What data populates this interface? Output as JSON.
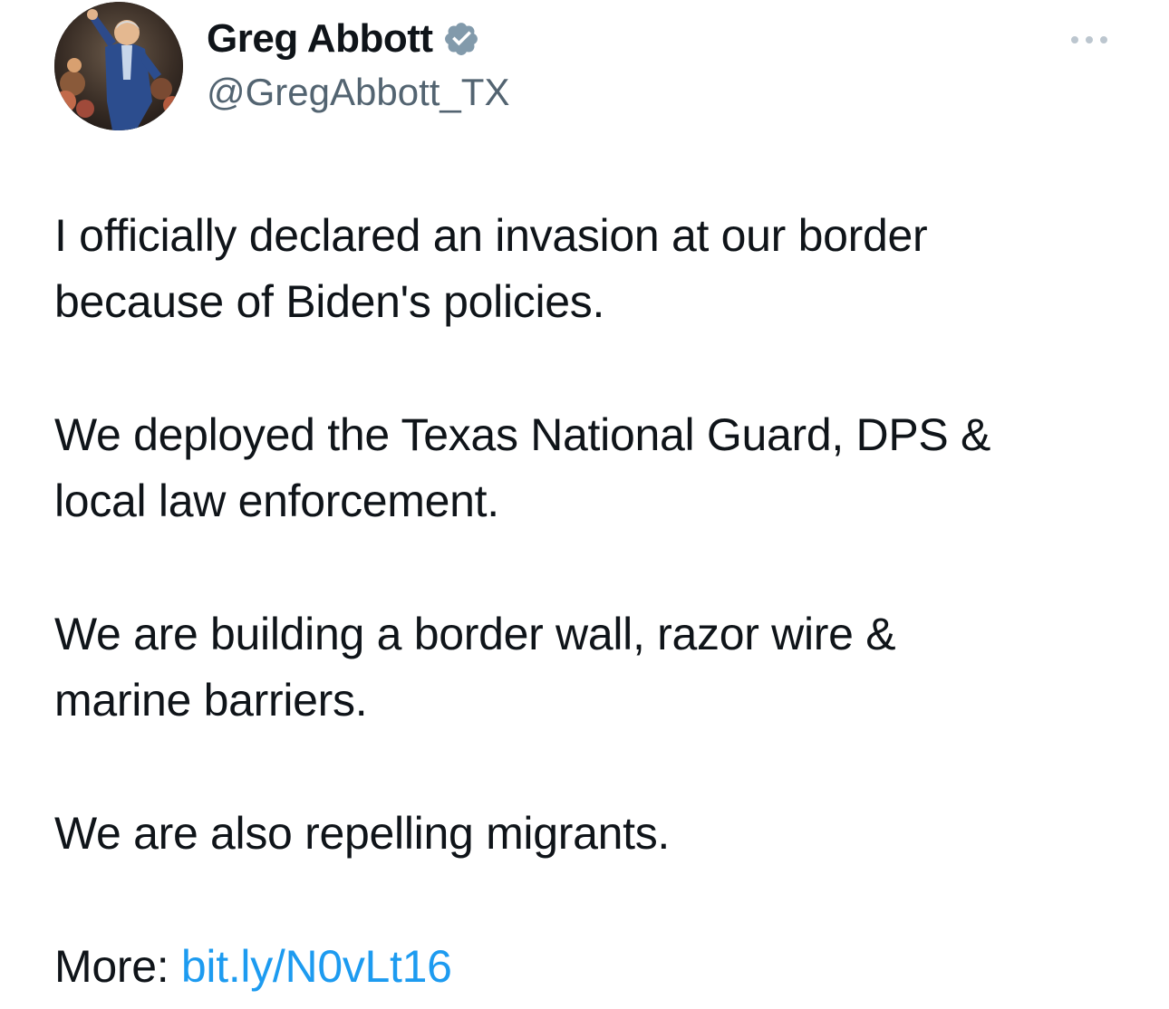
{
  "author": {
    "display_name": "Greg Abbott",
    "handle": "@GregAbbott_TX",
    "verified_icon": "verified-badge-icon",
    "verified_color": "#829aab"
  },
  "menu": {
    "icon": "more-options-icon"
  },
  "tweet": {
    "paragraphs": [
      [
        "I officially declared an invasion at our border",
        "because of Biden's policies."
      ],
      [
        "We deployed the Texas National Guard, DPS &",
        "local law enforcement."
      ],
      [
        "We are building a border wall, razor wire &",
        "marine barriers."
      ],
      [
        "We are also repelling migrants."
      ]
    ],
    "more_label": "More: ",
    "link_text": "bit.ly/N0vLt16"
  },
  "colors": {
    "text": "#0f1419",
    "secondary": "#536471",
    "link": "#1d9bf0"
  }
}
